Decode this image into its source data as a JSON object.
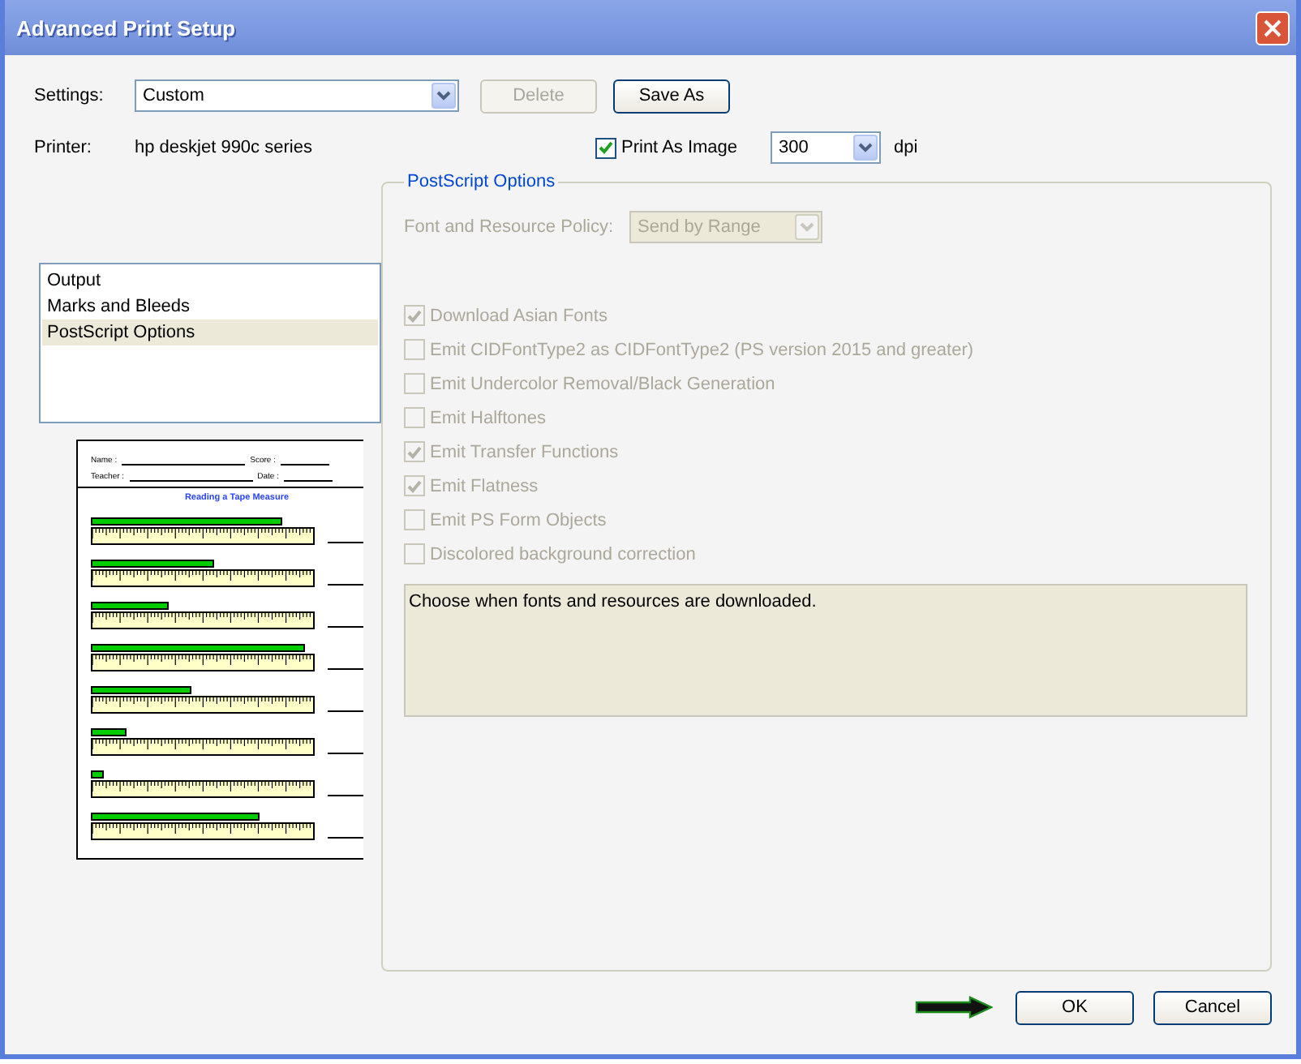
{
  "window": {
    "title": "Advanced Print Setup"
  },
  "settings": {
    "label": "Settings:",
    "value": "Custom"
  },
  "top_buttons": [
    {
      "label": "Delete",
      "disabled": true
    },
    {
      "label": "Save As",
      "disabled": false
    }
  ],
  "printer": {
    "label": "Printer:",
    "value": "hp deskjet 990c series"
  },
  "print_as_image": {
    "label": "Print As Image",
    "checked": true
  },
  "resolution": {
    "value": "300",
    "unit": "dpi"
  },
  "sidebar": {
    "items": [
      {
        "label": "Output",
        "selected": false
      },
      {
        "label": "Marks and Bleeds",
        "selected": false
      },
      {
        "label": "PostScript Options",
        "selected": true
      }
    ]
  },
  "preview": {
    "fields": [
      "Name :",
      "Score :",
      "Teacher :",
      "Date :"
    ],
    "title": "Reading a Tape Measure"
  },
  "postscript_options": {
    "title": "PostScript Options",
    "font_policy": {
      "label": "Font and Resource Policy:",
      "value": "Send by Range",
      "disabled": true
    },
    "options": [
      {
        "label": "Download Asian Fonts",
        "checked": true,
        "disabled": true
      },
      {
        "label": "Emit CIDFontType2 as CIDFontType2 (PS version 2015 and greater)",
        "checked": false,
        "disabled": true
      },
      {
        "label": "Emit Undercolor Removal/Black Generation",
        "checked": false,
        "disabled": true
      },
      {
        "label": "Emit Halftones",
        "checked": false,
        "disabled": true
      },
      {
        "label": "Emit Transfer Functions",
        "checked": true,
        "disabled": true
      },
      {
        "label": "Emit Flatness",
        "checked": true,
        "disabled": true
      },
      {
        "label": "Emit PS Form Objects",
        "checked": false,
        "disabled": true
      },
      {
        "label": "Discolored background correction",
        "checked": false,
        "disabled": true
      }
    ],
    "description": "Choose when fonts and resources are downloaded."
  },
  "footer_buttons": [
    {
      "label": "OK"
    },
    {
      "label": "Cancel"
    }
  ]
}
